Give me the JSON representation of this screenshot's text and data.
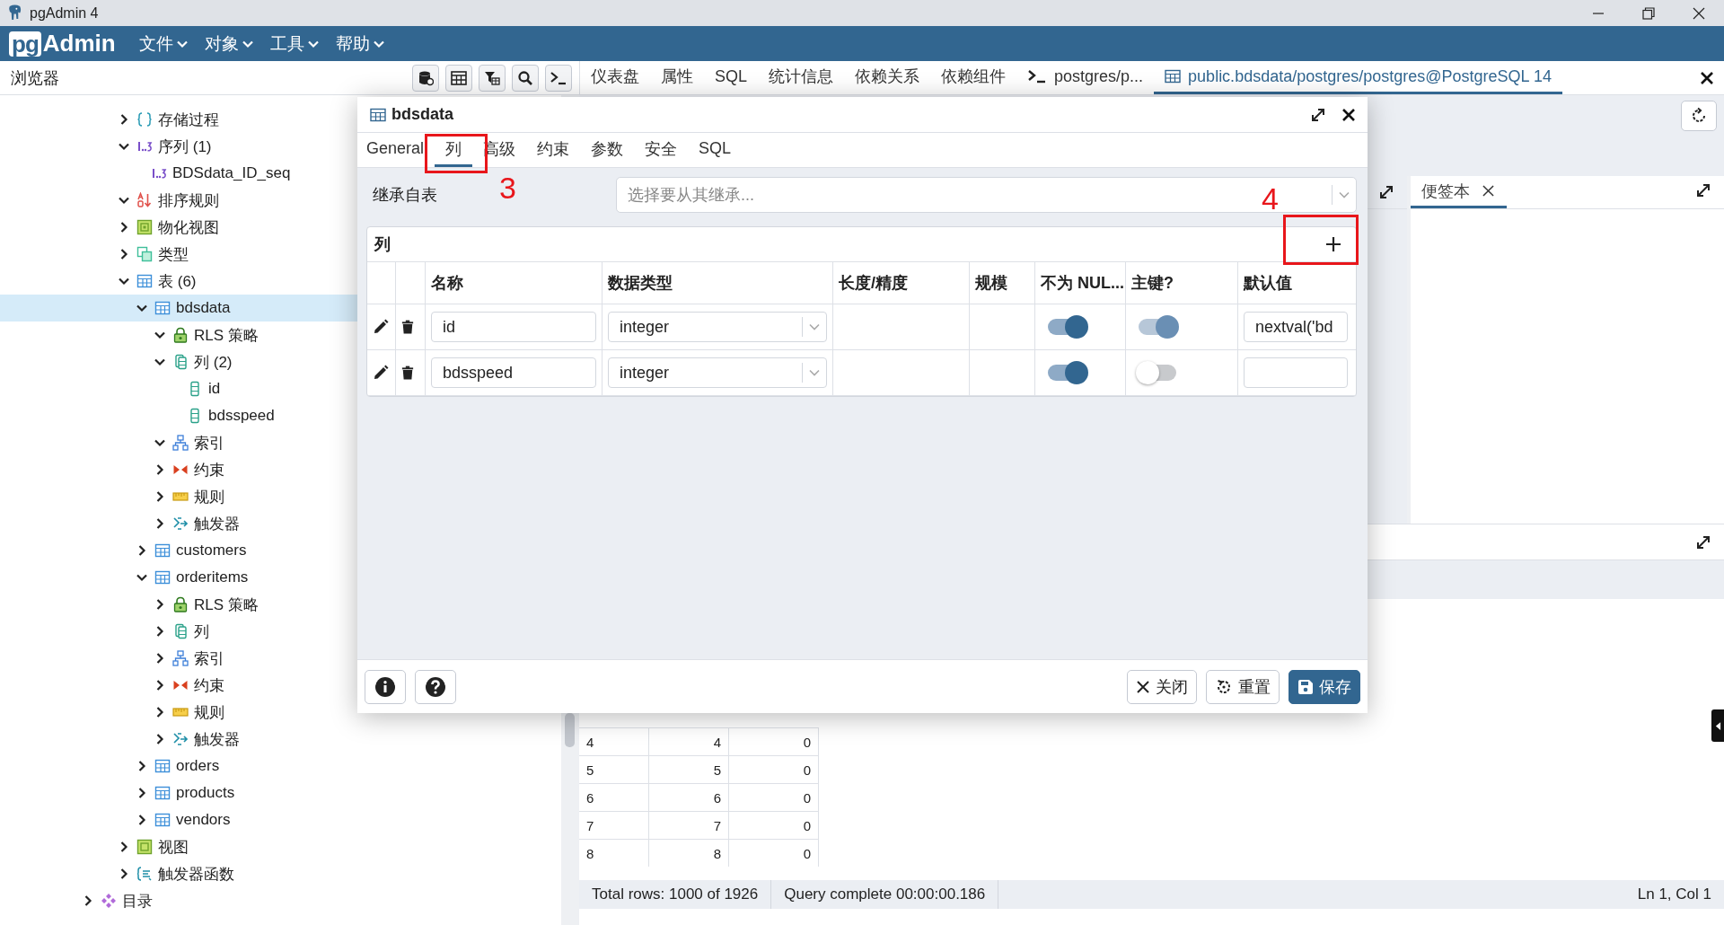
{
  "window": {
    "title": "pgAdmin 4"
  },
  "menubar": {
    "logo": {
      "prefix": "pg",
      "name": "Admin"
    },
    "menus": [
      "文件",
      "对象",
      "工具",
      "帮助"
    ]
  },
  "browser": {
    "title": "浏览器",
    "tree": {
      "schema_objects": [
        {
          "label": "存储过程",
          "kind": "procedure",
          "expanded": false,
          "selected": false
        },
        {
          "label": "序列 (1)",
          "kind": "sequence",
          "expanded": true,
          "selected": false,
          "children": [
            {
              "label": "BDSdata_ID_seq",
              "kind": "sequence",
              "selected": false
            }
          ]
        },
        {
          "label": "排序规则",
          "kind": "collation",
          "expanded": true,
          "selected": false
        },
        {
          "label": "物化视图",
          "kind": "matview",
          "expanded": false,
          "selected": false
        },
        {
          "label": "类型",
          "kind": "type",
          "expanded": false,
          "selected": false
        },
        {
          "label": "表 (6)",
          "kind": "table",
          "expanded": true,
          "selected": false,
          "children": [
            {
              "label": "bdsdata",
              "kind": "table",
              "expanded": true,
              "selected": true,
              "children": [
                {
                  "label": "RLS 策略",
                  "kind": "rls",
                  "expanded": true,
                  "selected": false
                },
                {
                  "label": "列 (2)",
                  "kind": "columns",
                  "expanded": true,
                  "selected": false,
                  "children": [
                    {
                      "label": "id",
                      "kind": "column",
                      "selected": false
                    },
                    {
                      "label": "bdsspeed",
                      "kind": "column",
                      "selected": false
                    }
                  ]
                },
                {
                  "label": "索引",
                  "kind": "index",
                  "expanded": true,
                  "selected": false
                },
                {
                  "label": "约束",
                  "kind": "constraint",
                  "expanded": false,
                  "selected": false
                },
                {
                  "label": "规则",
                  "kind": "rule",
                  "expanded": false,
                  "selected": false
                },
                {
                  "label": "触发器",
                  "kind": "trigger",
                  "expanded": false,
                  "selected": false
                }
              ]
            },
            {
              "label": "customers",
              "kind": "table",
              "expanded": false,
              "selected": false
            },
            {
              "label": "orderitems",
              "kind": "table",
              "expanded": true,
              "selected": false,
              "children": [
                {
                  "label": "RLS 策略",
                  "kind": "rls",
                  "expanded": false,
                  "selected": false
                },
                {
                  "label": "列",
                  "kind": "columns",
                  "expanded": false,
                  "selected": false
                },
                {
                  "label": "索引",
                  "kind": "index",
                  "expanded": false,
                  "selected": false
                },
                {
                  "label": "约束",
                  "kind": "constraint",
                  "expanded": false,
                  "selected": false
                },
                {
                  "label": "规则",
                  "kind": "rule",
                  "expanded": false,
                  "selected": false
                },
                {
                  "label": "触发器",
                  "kind": "trigger",
                  "expanded": false,
                  "selected": false
                }
              ]
            },
            {
              "label": "orders",
              "kind": "table",
              "expanded": false,
              "selected": false
            },
            {
              "label": "products",
              "kind": "table",
              "expanded": false,
              "selected": false
            },
            {
              "label": "vendors",
              "kind": "table",
              "expanded": false,
              "selected": false
            }
          ]
        },
        {
          "label": "视图",
          "kind": "view",
          "expanded": false,
          "selected": false
        },
        {
          "label": "触发器函数",
          "kind": "trigger-function",
          "expanded": false,
          "selected": false
        }
      ],
      "after": [
        {
          "label": "目录",
          "kind": "catalog",
          "expanded": false,
          "selected": false
        }
      ]
    }
  },
  "tabs": [
    {
      "label": "仪表盘",
      "kind": "plain",
      "selected": false
    },
    {
      "label": "属性",
      "kind": "plain",
      "selected": false
    },
    {
      "label": "SQL",
      "kind": "plain",
      "selected": false
    },
    {
      "label": "统计信息",
      "kind": "plain",
      "selected": false
    },
    {
      "label": "依赖关系",
      "kind": "plain",
      "selected": false
    },
    {
      "label": "依赖组件",
      "kind": "plain",
      "selected": false
    },
    {
      "label": "postgres/p...",
      "kind": "terminal",
      "selected": false
    },
    {
      "label": "public.bdsdata/postgres/postgres@PostgreSQL 14",
      "kind": "table",
      "selected": true
    }
  ],
  "scratch_pad": {
    "tab": "便签本"
  },
  "results": {
    "rows": [
      [
        "4",
        "4",
        "0"
      ],
      [
        "5",
        "5",
        "0"
      ],
      [
        "6",
        "6",
        "0"
      ],
      [
        "7",
        "7",
        "0"
      ],
      [
        "8",
        "8",
        "0"
      ]
    ],
    "status": {
      "total": "Total rows: 1000 of 1926",
      "query": "Query complete 00:00:00.186",
      "position": "Ln 1, Col 1"
    }
  },
  "dialog": {
    "title": "bdsdata",
    "tabs": [
      {
        "label": "General",
        "selected": false
      },
      {
        "label": "列",
        "selected": true
      },
      {
        "label": "高级",
        "selected": false
      },
      {
        "label": "约束",
        "selected": false
      },
      {
        "label": "参数",
        "selected": false
      },
      {
        "label": "安全",
        "selected": false
      },
      {
        "label": "SQL",
        "selected": false
      }
    ],
    "inherit": {
      "label": "继承自表",
      "placeholder": "选择要从其继承..."
    },
    "columns": {
      "title": "列",
      "headers": [
        "名称",
        "数据类型",
        "长度/精度",
        "规模",
        "不为 NUL...",
        "主键?",
        "默认值"
      ],
      "rows": [
        {
          "name": "id",
          "type": "integer",
          "not_null": {
            "on": true,
            "disabled": false
          },
          "primary_key": {
            "on": true,
            "disabled": true
          },
          "default": "nextval('bd"
        },
        {
          "name": "bdsspeed",
          "type": "integer",
          "not_null": {
            "on": true,
            "disabled": false
          },
          "primary_key": {
            "on": false,
            "disabled": false
          }
        }
      ]
    },
    "buttons": [
      {
        "label": "关闭",
        "kind": "close"
      },
      {
        "label": "重置",
        "kind": "reset"
      },
      {
        "label": "保存",
        "kind": "save"
      }
    ]
  },
  "annotations": [
    {
      "label": "3"
    },
    {
      "label": "4"
    }
  ]
}
